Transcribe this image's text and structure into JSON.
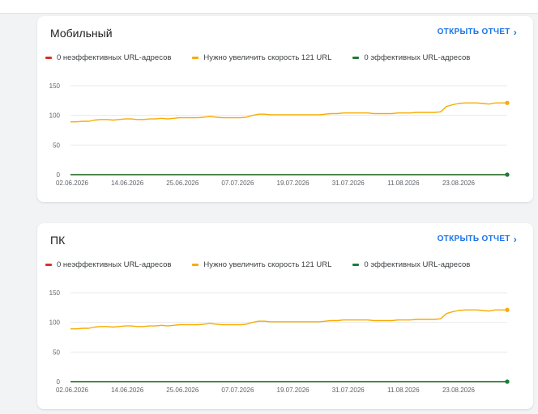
{
  "colors": {
    "red": "#d93025",
    "orange": "#f9ab00",
    "green": "#188038",
    "accent": "#1a73e8",
    "grid": "#e8eaed"
  },
  "cards": [
    {
      "title": "Мобильный",
      "open_report": "ОТКРЫТЬ ОТЧЕТ",
      "legend": [
        {
          "label": "0 неэффективных URL-адресов",
          "color_key": "red"
        },
        {
          "label": "Нужно увеличить скорость 121 URL",
          "color_key": "orange"
        },
        {
          "label": "0 эффективных URL-адресов",
          "color_key": "green"
        }
      ]
    },
    {
      "title": "ПК",
      "open_report": "ОТКРЫТЬ ОТЧЕТ",
      "legend": [
        {
          "label": "0 неэффективных URL-адресов",
          "color_key": "red"
        },
        {
          "label": "Нужно увеличить скорость 121 URL",
          "color_key": "orange"
        },
        {
          "label": "0 эффективных URL-адресов",
          "color_key": "green"
        }
      ]
    }
  ],
  "chart_data": [
    {
      "type": "line",
      "ylim": [
        0,
        150
      ],
      "yticks": [
        0,
        50,
        100,
        150
      ],
      "x_tick_labels": [
        "02.06.2026",
        "14.06.2026",
        "25.06.2026",
        "07.07.2026",
        "19.07.2026",
        "31.07.2026",
        "11.08.2026",
        "23.08.2026"
      ],
      "series": [
        {
          "name": "Нужно увеличить скорость 121 URL",
          "color_key": "orange",
          "values": [
            89,
            89,
            90,
            90,
            92,
            93,
            93,
            92,
            93,
            94,
            94,
            93,
            93,
            94,
            94,
            95,
            94,
            95,
            96,
            96,
            96,
            96,
            97,
            98,
            97,
            96,
            96,
            96,
            96,
            97,
            100,
            102,
            102,
            101,
            101,
            101,
            101,
            101,
            101,
            101,
            101,
            101,
            102,
            103,
            103,
            104,
            104,
            104,
            104,
            104,
            103,
            103,
            103,
            103,
            104,
            104,
            104,
            105,
            105,
            105,
            105,
            106,
            115,
            118,
            120,
            121,
            121,
            121,
            120,
            119,
            121,
            121,
            121
          ]
        },
        {
          "name": "0 неэффективных URL-адресов",
          "color_key": "red",
          "values": [
            0,
            0
          ]
        },
        {
          "name": "0 эффективных URL-адресов",
          "color_key": "green",
          "values": [
            0,
            0
          ]
        }
      ]
    },
    {
      "type": "line",
      "ylim": [
        0,
        150
      ],
      "yticks": [
        0,
        50,
        100,
        150
      ],
      "x_tick_labels": [
        "02.06.2026",
        "14.06.2026",
        "25.06.2026",
        "07.07.2026",
        "19.07.2026",
        "31.07.2026",
        "11.08.2026",
        "23.08.2026"
      ],
      "series": [
        {
          "name": "Нужно увеличить скорость 121 URL",
          "color_key": "orange",
          "values": [
            89,
            89,
            90,
            90,
            92,
            93,
            93,
            92,
            93,
            94,
            94,
            93,
            93,
            94,
            94,
            95,
            94,
            95,
            96,
            96,
            96,
            96,
            97,
            98,
            97,
            96,
            96,
            96,
            96,
            97,
            100,
            102,
            102,
            101,
            101,
            101,
            101,
            101,
            101,
            101,
            101,
            101,
            102,
            103,
            103,
            104,
            104,
            104,
            104,
            104,
            103,
            103,
            103,
            103,
            104,
            104,
            104,
            105,
            105,
            105,
            105,
            106,
            115,
            118,
            120,
            121,
            121,
            121,
            120,
            119,
            121,
            121,
            121
          ]
        },
        {
          "name": "0 неэффективных URL-адресов",
          "color_key": "red",
          "values": [
            0,
            0
          ]
        },
        {
          "name": "0 эффективных URL-адресов",
          "color_key": "green",
          "values": [
            0,
            0
          ]
        }
      ]
    }
  ]
}
